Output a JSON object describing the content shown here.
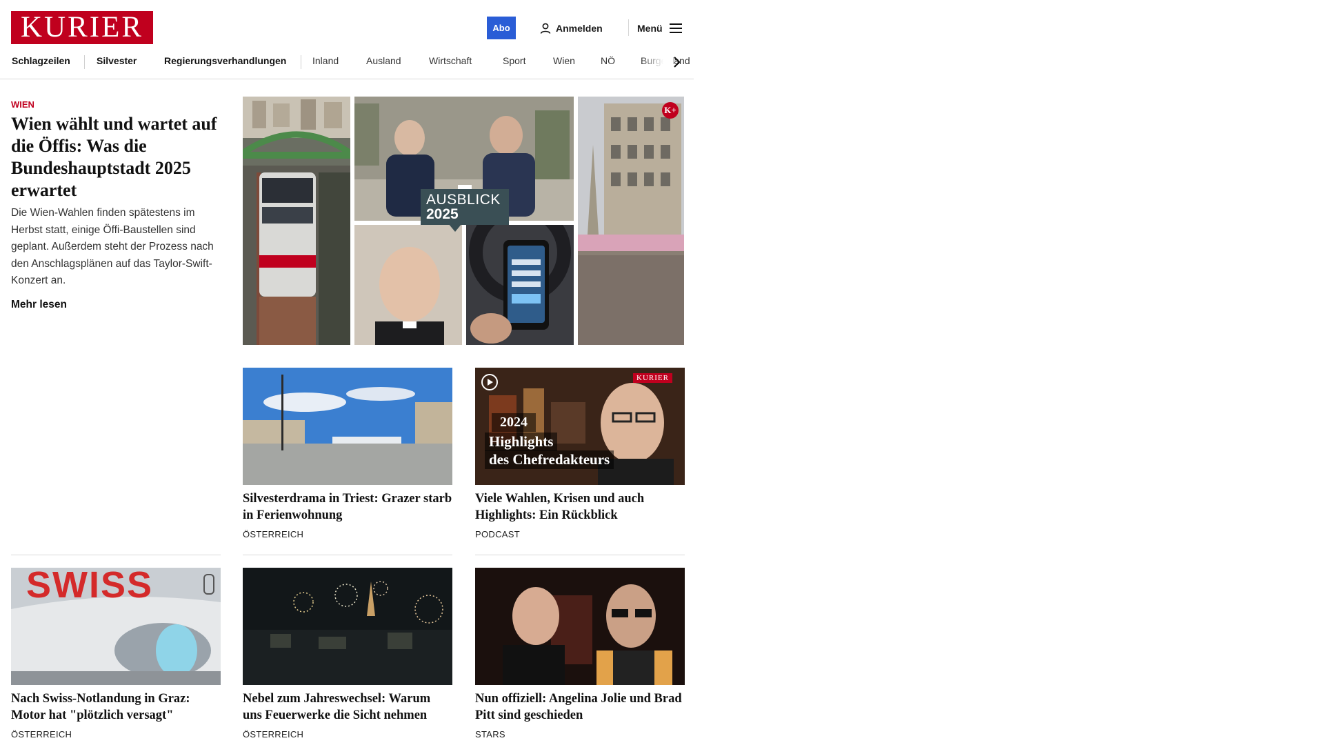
{
  "header": {
    "logo_text": "KURIER",
    "abo_label": "Abo",
    "login_label": "Anmelden",
    "menu_label": "Menü",
    "brand_color": "#c0001e",
    "accent_color": "#2a5dd6"
  },
  "nav": {
    "items": [
      "Schlagzeilen",
      "Silvester",
      "Regierungsverhandlungen",
      "Inland",
      "Ausland",
      "Wirtschaft",
      "Sport",
      "Wien",
      "NÖ",
      "Burgenland"
    ],
    "more_icon": "chevron-right-icon"
  },
  "lead": {
    "kicker": "WIEN",
    "title": "Wien wählt und wartet auf die Öffis: Was die Bundeshauptstadt 2025 erwartet",
    "teaser": "Die Wien-Wahlen finden spätestens im Herbst statt, einige Öffi-Baustellen sind geplant. Außerdem steht der Prozess nach den Anschlagsplänen auf das Taylor-Swift-Konzert an.",
    "more_label": "Mehr lesen",
    "image_caption_line1": "AUSBLICK",
    "image_caption_line2": "2025",
    "premium_badge": "K+"
  },
  "cards": [
    {
      "title": "Silvesterdrama in Triest: Grazer starb in Ferienwohnung",
      "category": "Österreich"
    },
    {
      "title": "Viele Wahlen, Krisen und auch Highlights: Ein Rückblick",
      "category": "Podcast",
      "overlay_year": "2024",
      "overlay_line1": "Highlights",
      "overlay_line2": "des Chefredakteurs",
      "overlay_brand": "KURIER"
    },
    {
      "title": "Nach Swiss-Notlandung in Graz: Motor hat \"plötzlich versagt\"",
      "category": "Österreich",
      "overlay_brand": "SWISS"
    },
    {
      "title": "Nebel zum Jahreswechsel: Warum uns Feuerwerke die Sicht nehmen",
      "category": "Österreich"
    },
    {
      "title": "Nun offiziell: Angelina Jolie und Brad Pitt sind geschieden",
      "category": "Stars"
    }
  ]
}
